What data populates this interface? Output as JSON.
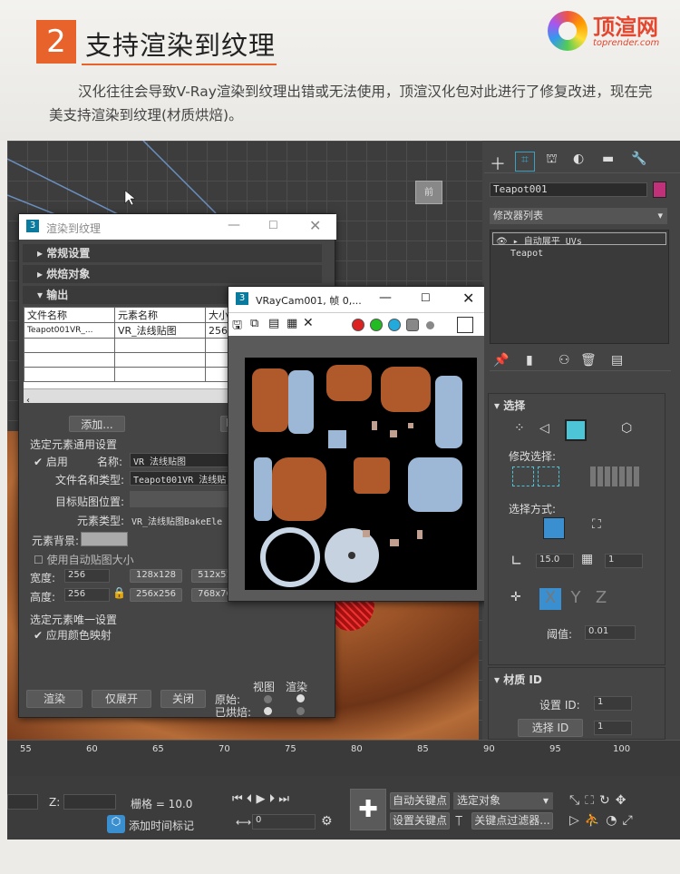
{
  "header": {
    "number": "2",
    "title": "支持渲染到纹理",
    "paragraph": "汉化往往会导致V-Ray渲染到纹理出错或无法使用，顶渲汉化包对此进行了修复改进，现在完美支持渲染到纹理(材质烘焙)。",
    "logo_text": "顶渲网",
    "logo_url": "toprender.com"
  },
  "rtt_dialog": {
    "title": "渲染到纹理",
    "sections": [
      "常规设置",
      "烘焙对象",
      "输出"
    ],
    "table_headers": [
      "文件名称",
      "元素名称",
      "大小"
    ],
    "table_row": [
      "Teapot001VR_...",
      "VR_法线贴图",
      "256x"
    ],
    "add_button": "添加...",
    "group1_title": "选定元素通用设置",
    "enable_label": "启用",
    "name_label": "名称:",
    "name_value": "VR_法线贴图",
    "file_label": "文件名和类型:",
    "file_value": "Teapot001VR_法线贴",
    "target_label": "目标贴图位置:",
    "type_label": "元素类型:",
    "type_value": "VR_法线贴图BakeEle",
    "bg_label": "元素背景:",
    "auto_size_label": "使用自动贴图大小",
    "width_label": "宽度:",
    "width_value": "256",
    "height_label": "高度:",
    "height_value": "256",
    "presets": [
      "128x128",
      "512x51",
      "256x256",
      "768x76"
    ],
    "group2_title": "选定元素唯一设置",
    "color_map_label": "应用颜色映射",
    "render_button": "渲染",
    "unwrap_button": "仅展开",
    "close_button": "关闭",
    "original_label": "原始:",
    "baked_label": "已烘焙:",
    "view_label": "视图",
    "render_label": "渲染"
  },
  "vfb": {
    "title": "VRayCam001, 帧 0,..."
  },
  "command_panel": {
    "object_name": "Teapot001",
    "modifier_list": "修改器列表",
    "stack": [
      "自动展平 UVs",
      "Teapot"
    ],
    "select_section": "选择",
    "modify_select_label": "修改选择:",
    "select_by_label": "选择方式:",
    "angle_value": "15.0",
    "step_value": "1",
    "threshold_label": "阈值:",
    "threshold_value": "0.01",
    "material_section": "材质 ID",
    "set_id_label": "设置 ID:",
    "set_id_value": "1",
    "select_id_button": "选择 ID",
    "select_id_value": "1",
    "accent_color": "#c0317a",
    "selected_color": "#4ec5d6"
  },
  "timeline": {
    "ticks": [
      "55",
      "60",
      "65",
      "70",
      "75",
      "80",
      "85",
      "90",
      "95",
      "100"
    ]
  },
  "bottom_bar": {
    "z_label": "Z:",
    "grid_label": "栅格 = 10.0",
    "add_time_tag": "添加时间标记",
    "auto_key": "自动关键点",
    "set_key": "设置关键点",
    "selected_object": "选定对象",
    "key_filter": "关键点过滤器...",
    "frame_value": "0"
  }
}
